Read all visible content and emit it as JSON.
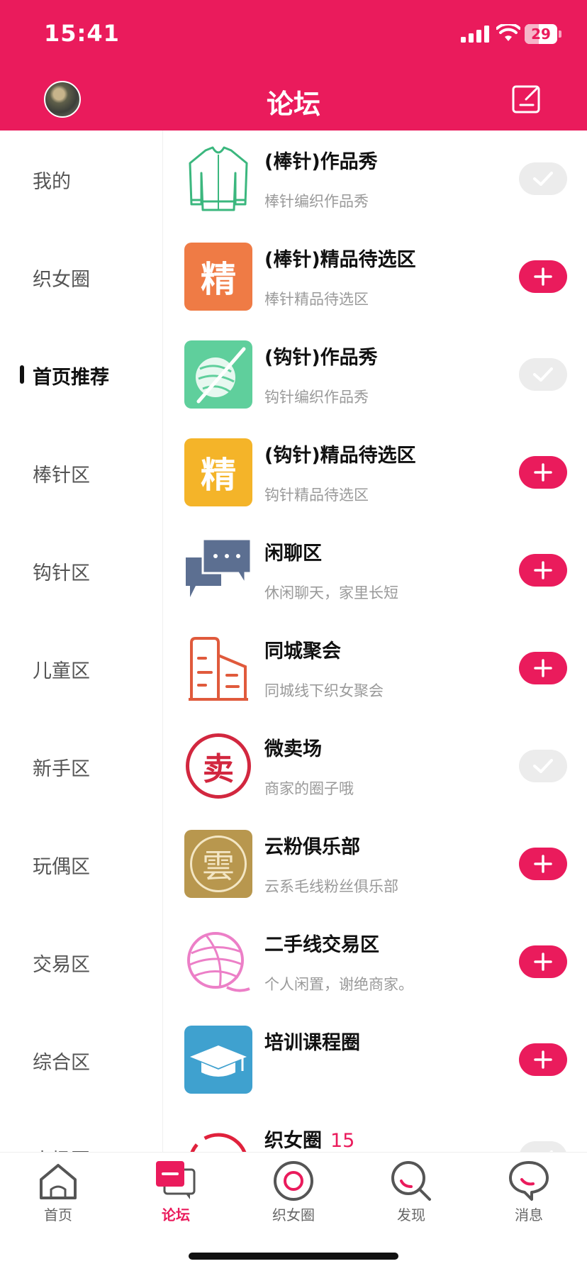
{
  "status_bar": {
    "time": "15:41",
    "battery": "29"
  },
  "header": {
    "title": "论坛",
    "avatar_icon": "user-avatar",
    "compose_icon": "compose-icon"
  },
  "sidebar": {
    "items": [
      {
        "label": "我的",
        "active": false
      },
      {
        "label": "织女圈",
        "active": false
      },
      {
        "label": "首页推荐",
        "active": true
      },
      {
        "label": "棒针区",
        "active": false
      },
      {
        "label": "钩针区",
        "active": false
      },
      {
        "label": "儿童区",
        "active": false
      },
      {
        "label": "新手区",
        "active": false
      },
      {
        "label": "玩偶区",
        "active": false
      },
      {
        "label": "交易区",
        "active": false
      },
      {
        "label": "综合区",
        "active": false
      },
      {
        "label": "卖场圈",
        "active": false
      }
    ]
  },
  "forums": [
    {
      "title": "(棒针)作品秀",
      "subtitle": "棒针编织作品秀",
      "joined": true,
      "icon": "cardigan-icon"
    },
    {
      "title": "(棒针)精品待选区",
      "subtitle": "棒针精品待选区",
      "joined": false,
      "icon": "精",
      "icon_color": "#ef7b45"
    },
    {
      "title": "(钩针)作品秀",
      "subtitle": "钩针编织作品秀",
      "joined": true,
      "icon": "yarn-hook-icon",
      "icon_color": "#5fcf9c"
    },
    {
      "title": "(钩针)精品待选区",
      "subtitle": "钩针精品待选区",
      "joined": false,
      "icon": "精",
      "icon_color": "#f4b429"
    },
    {
      "title": "闲聊区",
      "subtitle": "休闲聊天，家里长短",
      "joined": false,
      "icon": "chat-bubbles-icon",
      "icon_color": "#5c6f91"
    },
    {
      "title": "同城聚会",
      "subtitle": "同城线下织女聚会",
      "joined": false,
      "icon": "city-buildings-icon",
      "icon_color": "#e05a3c"
    },
    {
      "title": "微卖场",
      "subtitle": "商家的圈子哦",
      "joined": true,
      "icon": "卖",
      "icon_color": "#d2273f"
    },
    {
      "title": "云粉俱乐部",
      "subtitle": "云系毛线粉丝俱乐部",
      "joined": false,
      "icon": "雲",
      "icon_color": "#b8974e"
    },
    {
      "title": "二手线交易区",
      "subtitle": "个人闲置，谢绝商家。",
      "joined": false,
      "icon": "yarn-ball-icon",
      "icon_color": "#ec7fc7"
    },
    {
      "title": "培训课程圈",
      "subtitle": "",
      "joined": false,
      "icon": "graduation-cap-icon",
      "icon_color": "#3fa1cf"
    },
    {
      "title": "织女圈",
      "count": "15",
      "subtitle": "",
      "joined": true,
      "icon": "smile-circle-icon",
      "icon_color": "#e0213c"
    }
  ],
  "tabbar": {
    "items": [
      {
        "label": "首页",
        "icon": "home-icon",
        "active": false
      },
      {
        "label": "论坛",
        "icon": "forum-icon",
        "active": true
      },
      {
        "label": "织女圈",
        "icon": "circle-icon",
        "active": false
      },
      {
        "label": "发现",
        "icon": "search-icon",
        "active": false
      },
      {
        "label": "消息",
        "icon": "message-icon",
        "active": false
      }
    ]
  },
  "colors": {
    "brand": "#ea1b5c",
    "joined_bg": "#ececec"
  }
}
